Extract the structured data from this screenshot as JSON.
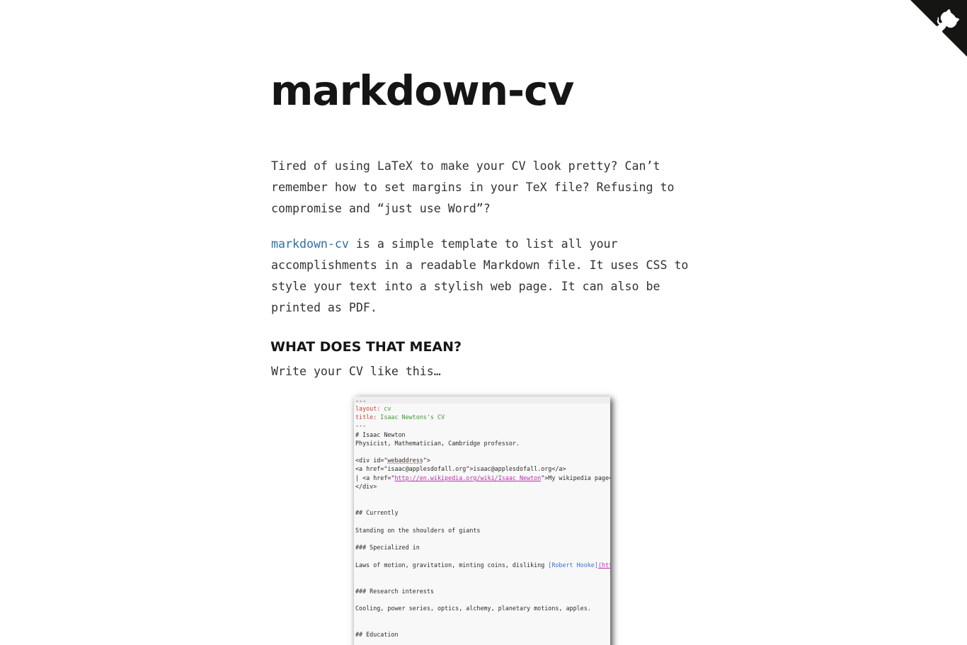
{
  "page": {
    "title": "markdown-cv",
    "intro": "Tired of using LaTeX to make your CV look pretty? Can’t remember how to set margins in your TeX file? Refusing to compromise and “just use Word”?",
    "desc_link": "markdown-cv",
    "desc_rest": " is a simple template to list all your accomplishments in a readable Markdown file. It uses CSS to style your text into a stylish web page. It can also be printed as PDF.",
    "section_heading": "WHAT DOES THAT MEAN?",
    "section_text": "Write your CV like this…"
  },
  "github_corner": {
    "icon": "github-octocat-icon",
    "bg_color": "#151513",
    "fg_color": "#ffffff"
  },
  "editor_screenshot": {
    "lines": {
      "l0": "---",
      "l1_key": "layout: ",
      "l1_val": "cv",
      "l2_key": "title: ",
      "l2_val": "Isaac Newtons's CV",
      "l3": "---",
      "l4": "# Isaac Newton",
      "l5": "Physicist, Mathematician, Cambridge professor.",
      "l6_a": "<div id=\"",
      "l6_b": "webaddress",
      "l6_c": "\">",
      "l7": "<a href=\"isaac@applesdofall.org\">isaac@applesdofall.org</a>",
      "l8_a": "| <a href=\"",
      "l8_b": "http://en.wikipedia.org/wiki/Isaac_Newton",
      "l8_c": "\">My wikipedia page</",
      "l9": "</div>",
      "l10": "## Currently",
      "l11": "Standing on the shoulders of giants",
      "l12": "### Specialized in",
      "l13_a": "Laws of motion, gravitation, minting coins, disliking ",
      "l13_b": "[Robert Hooke]",
      "l13_c": "(http",
      "l14": "### Research interests",
      "l15": "Cooling, power series, optics, alchemy, planetary motions, apples.",
      "l16": "## Education"
    }
  },
  "colors": {
    "text": "#333333",
    "heading": "#151515",
    "link": "#2e6faa"
  }
}
